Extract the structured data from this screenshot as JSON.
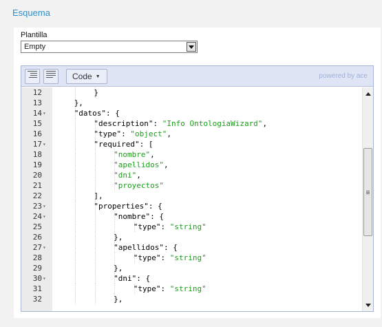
{
  "section": {
    "title": "Esquema"
  },
  "template_field": {
    "label": "Plantilla",
    "value": "Empty"
  },
  "toolbar": {
    "code_label": "Code",
    "powered_by": "powered by ace"
  },
  "icons": {
    "indent": "indent-icon",
    "outdent": "outdent-icon",
    "dropdown": "chevron-down-icon"
  },
  "editor": {
    "lines": [
      {
        "num": "12",
        "fold": false,
        "indent": 2,
        "tokens": [
          [
            "p",
            "}"
          ]
        ]
      },
      {
        "num": "13",
        "fold": false,
        "indent": 1,
        "tokens": [
          [
            "p",
            "},"
          ]
        ]
      },
      {
        "num": "14",
        "fold": true,
        "indent": 1,
        "tokens": [
          [
            "k",
            "\"datos\""
          ],
          [
            "p",
            ": {"
          ]
        ]
      },
      {
        "num": "15",
        "fold": false,
        "indent": 2,
        "tokens": [
          [
            "k",
            "\"description\""
          ],
          [
            "p",
            ": "
          ],
          [
            "s",
            "\"Info OntologiaWizard\""
          ],
          [
            "p",
            ","
          ]
        ]
      },
      {
        "num": "16",
        "fold": false,
        "indent": 2,
        "tokens": [
          [
            "k",
            "\"type\""
          ],
          [
            "p",
            ": "
          ],
          [
            "s",
            "\"object\""
          ],
          [
            "p",
            ","
          ]
        ]
      },
      {
        "num": "17",
        "fold": true,
        "indent": 2,
        "tokens": [
          [
            "k",
            "\"required\""
          ],
          [
            "p",
            ": ["
          ]
        ]
      },
      {
        "num": "18",
        "fold": false,
        "indent": 3,
        "tokens": [
          [
            "s",
            "\"nombre\""
          ],
          [
            "p",
            ","
          ]
        ]
      },
      {
        "num": "19",
        "fold": false,
        "indent": 3,
        "tokens": [
          [
            "s",
            "\"apellidos\""
          ],
          [
            "p",
            ","
          ]
        ]
      },
      {
        "num": "20",
        "fold": false,
        "indent": 3,
        "tokens": [
          [
            "s",
            "\"dni\""
          ],
          [
            "p",
            ","
          ]
        ]
      },
      {
        "num": "21",
        "fold": false,
        "indent": 3,
        "tokens": [
          [
            "s",
            "\"proyectos\""
          ]
        ]
      },
      {
        "num": "22",
        "fold": false,
        "indent": 2,
        "tokens": [
          [
            "p",
            "],"
          ]
        ]
      },
      {
        "num": "23",
        "fold": true,
        "indent": 2,
        "tokens": [
          [
            "k",
            "\"properties\""
          ],
          [
            "p",
            ": {"
          ]
        ]
      },
      {
        "num": "24",
        "fold": true,
        "indent": 3,
        "tokens": [
          [
            "k",
            "\"nombre\""
          ],
          [
            "p",
            ": {"
          ]
        ]
      },
      {
        "num": "25",
        "fold": false,
        "indent": 4,
        "tokens": [
          [
            "k",
            "\"type\""
          ],
          [
            "p",
            ": "
          ],
          [
            "s",
            "\"string\""
          ]
        ]
      },
      {
        "num": "26",
        "fold": false,
        "indent": 3,
        "tokens": [
          [
            "p",
            "},"
          ]
        ]
      },
      {
        "num": "27",
        "fold": true,
        "indent": 3,
        "tokens": [
          [
            "k",
            "\"apellidos\""
          ],
          [
            "p",
            ": {"
          ]
        ]
      },
      {
        "num": "28",
        "fold": false,
        "indent": 4,
        "tokens": [
          [
            "k",
            "\"type\""
          ],
          [
            "p",
            ": "
          ],
          [
            "s",
            "\"string\""
          ]
        ]
      },
      {
        "num": "29",
        "fold": false,
        "indent": 3,
        "tokens": [
          [
            "p",
            "},"
          ]
        ]
      },
      {
        "num": "30",
        "fold": true,
        "indent": 3,
        "tokens": [
          [
            "k",
            "\"dni\""
          ],
          [
            "p",
            ": {"
          ]
        ]
      },
      {
        "num": "31",
        "fold": false,
        "indent": 4,
        "tokens": [
          [
            "k",
            "\"type\""
          ],
          [
            "p",
            ": "
          ],
          [
            "s",
            "\"string\""
          ]
        ]
      },
      {
        "num": "32",
        "fold": false,
        "indent": 3,
        "tokens": [
          [
            "p",
            "},"
          ]
        ]
      }
    ]
  },
  "colors": {
    "title": "#2e8fc9",
    "string": "#1a9e1a",
    "toolbar_bg": "#dfe5f5",
    "powered_by": "#9fb0d9"
  }
}
